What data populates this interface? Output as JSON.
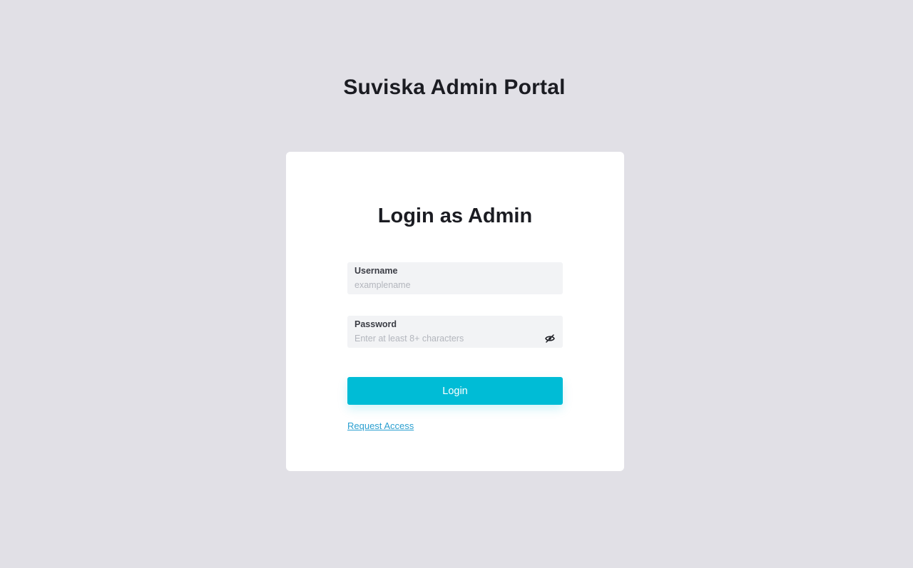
{
  "header": {
    "portal_title": "Suviska Admin Portal"
  },
  "login_card": {
    "title": "Login as Admin",
    "username": {
      "label": "Username",
      "value": "",
      "placeholder": "examplename"
    },
    "password": {
      "label": "Password",
      "value": "",
      "placeholder": "Enter at least 8+ characters",
      "toggle_icon": "eye-slash-icon"
    },
    "login_button_label": "Login",
    "request_access_label": "Request Access"
  },
  "colors": {
    "background": "#e1e0e6",
    "card": "#ffffff",
    "field": "#f2f3f5",
    "accent": "#00bcd6",
    "link": "#2a9fd0",
    "heading": "#1b1c22"
  }
}
